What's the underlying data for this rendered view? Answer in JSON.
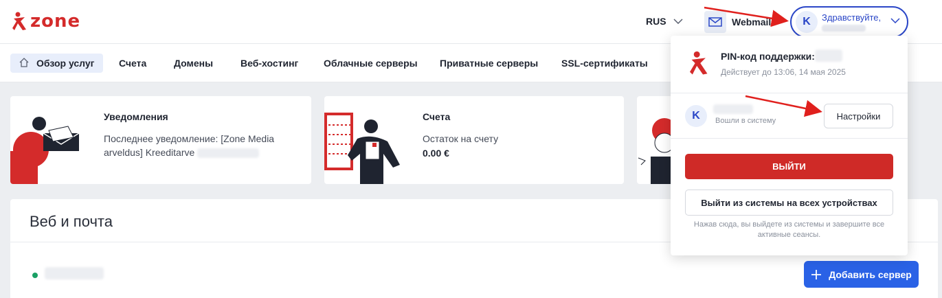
{
  "header": {
    "logo_text": "zone",
    "brand_color": "#d42b2b",
    "language": "RUS",
    "webmail_label": "Webmail",
    "user_initial": "K",
    "greeting": "Здравствуйте,"
  },
  "nav": {
    "items": [
      {
        "label": "Обзор услуг",
        "active": true
      },
      {
        "label": "Счета"
      },
      {
        "label": "Домены"
      },
      {
        "label": "Веб-хостинг"
      },
      {
        "label": "Облачные серверы"
      },
      {
        "label": "Приватные серверы"
      },
      {
        "label": "SSL-сертификаты"
      }
    ]
  },
  "cards": {
    "notifications": {
      "title": "Уведомления",
      "text": "Последнее уведомление: [Zone Media arveldus] Kreeditarve"
    },
    "accounts": {
      "title": "Счета",
      "text": "Остаток на счету",
      "balance": "0.00 €"
    }
  },
  "section": {
    "title": "Веб и почта",
    "add_button": "Добавить сервер",
    "status_color": "#1aa065"
  },
  "dropdown": {
    "pin_title": "PIN-код поддержки:",
    "pin_valid": "Действует до 13:06, 14 мая 2025",
    "user_initial": "K",
    "logged_in": "Вошли в систему",
    "settings": "Настройки",
    "logout": "ВЫЙТИ",
    "logout_all": "Выйти из системы на всех устройствах",
    "hint": "Нажав сюда, вы выйдете из системы и завершите все активные сеансы."
  }
}
